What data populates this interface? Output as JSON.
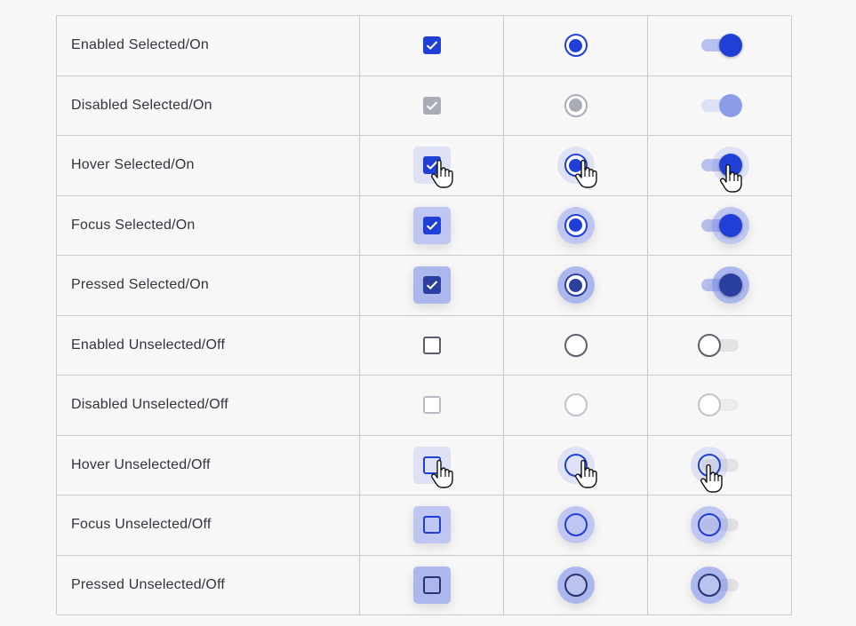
{
  "rows": [
    {
      "label": "Enabled Selected/On"
    },
    {
      "label": "Disabled Selected/On"
    },
    {
      "label": "Hover Selected/On"
    },
    {
      "label": "Focus Selected/On"
    },
    {
      "label": "Pressed Selected/On"
    },
    {
      "label": "Enabled Unselected/Off"
    },
    {
      "label": "Disabled Unselected/Off"
    },
    {
      "label": "Hover Unselected/Off"
    },
    {
      "label": "Focus Unselected/Off"
    },
    {
      "label": "Pressed Unselected/Off"
    }
  ],
  "controls": [
    "checkbox",
    "radio-button",
    "toggle-switch"
  ],
  "icons": {
    "checkmark": "check-icon",
    "pointer": "hand-pointer-icon"
  },
  "colors": {
    "primary": "#1f3fd6",
    "pressed": "#2a3f9e",
    "disabled": "#a9acb6",
    "border": "#5b5e6b",
    "halo": "#7084e6",
    "grid_line": "#c9c9ce",
    "background": "#f7f7f8"
  }
}
